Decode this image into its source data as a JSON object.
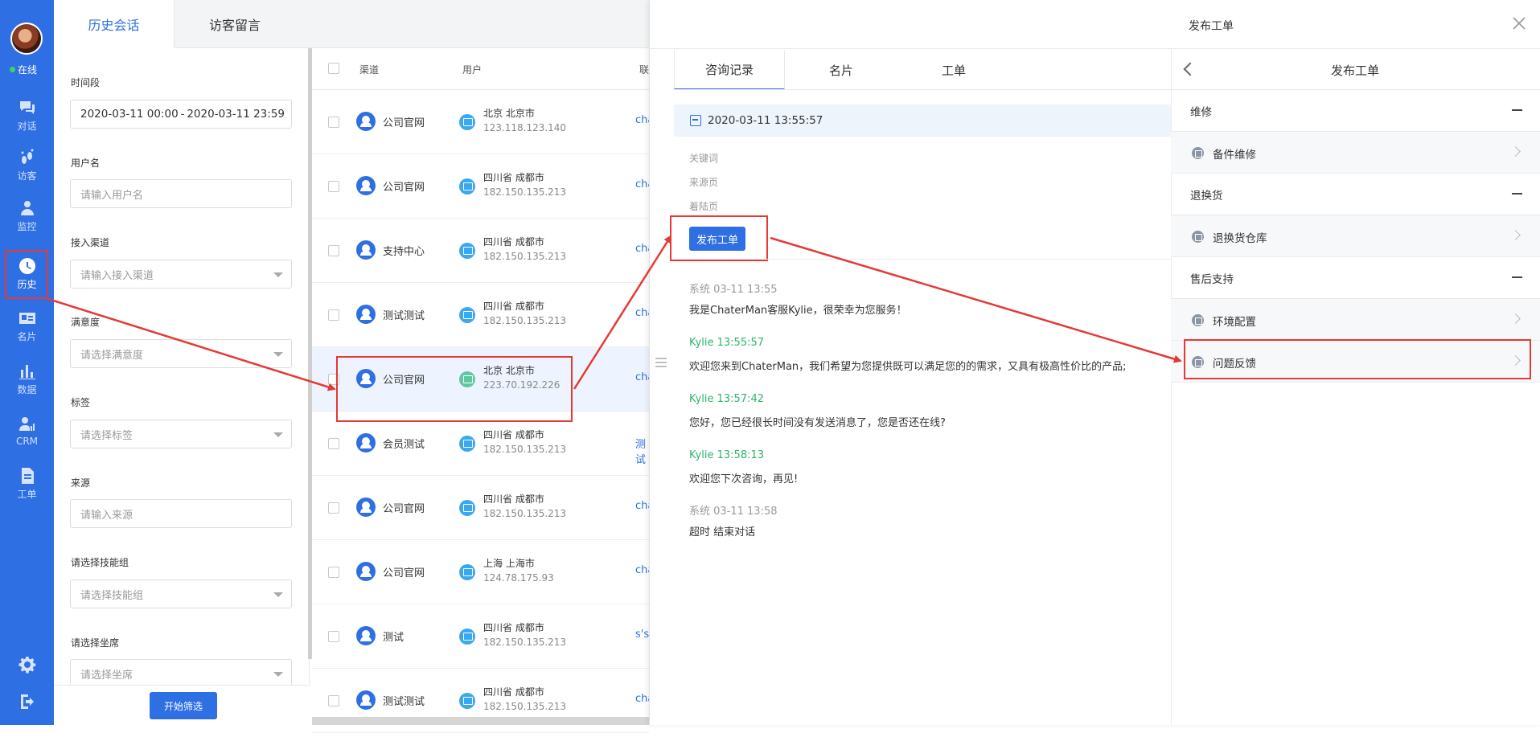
{
  "nav": {
    "status": "在线",
    "items": [
      {
        "label": "对话",
        "icon": "chat-icon"
      },
      {
        "label": "访客",
        "icon": "footprint-icon"
      },
      {
        "label": "监控",
        "icon": "monitor-user-icon"
      },
      {
        "label": "历史",
        "icon": "clock-icon"
      },
      {
        "label": "名片",
        "icon": "card-icon"
      },
      {
        "label": "数据",
        "icon": "bar-chart-icon"
      },
      {
        "label": "CRM",
        "icon": "crm-icon"
      },
      {
        "label": "工单",
        "icon": "ticket-icon"
      }
    ]
  },
  "tabs": {
    "history": "历史会话",
    "messages": "访客留言"
  },
  "filter": {
    "time_label": "时间段",
    "date_start": "2020-03-11 00:00",
    "date_sep": "-",
    "date_end": "2020-03-11 23:59",
    "username_label": "用户名",
    "username_placeholder": "请输入用户名",
    "channel_label": "接入渠道",
    "channel_placeholder": "请输入接入渠道",
    "satisfaction_label": "满意度",
    "satisfaction_placeholder": "请选择满意度",
    "tag_label": "标签",
    "tag_placeholder": "请选择标签",
    "source_label": "来源",
    "source_placeholder": "请输入来源",
    "skill_label": "请选择技能组",
    "skill_placeholder": "请选择技能组",
    "seat_label": "请选择坐席",
    "seat_placeholder": "请选择坐席",
    "submit": "开始筛选"
  },
  "list": {
    "headers": {
      "channel": "渠道",
      "user": "用户",
      "contact": "联"
    },
    "rows": [
      {
        "channel": "公司官网",
        "loc": "北京 北京市",
        "ip": "123.118.123.140",
        "contact": "cha",
        "device": "pc"
      },
      {
        "channel": "公司官网",
        "loc": "四川省 成都市",
        "ip": "182.150.135.213",
        "contact": "cha",
        "device": "pc"
      },
      {
        "channel": "支持中心",
        "loc": "四川省 成都市",
        "ip": "182.150.135.213",
        "contact": "cha",
        "device": "pc"
      },
      {
        "channel": "测试测试",
        "loc": "四川省 成都市",
        "ip": "182.150.135.213",
        "contact": "cha",
        "device": "pc"
      },
      {
        "channel": "公司官网",
        "loc": "北京 北京市",
        "ip": "223.70.192.226",
        "contact": "cha",
        "device": "mobile"
      },
      {
        "channel": "会员测试",
        "loc": "四川省 成都市",
        "ip": "182.150.135.213",
        "contact": "测试",
        "device": "pc"
      },
      {
        "channel": "公司官网",
        "loc": "四川省 成都市",
        "ip": "182.150.135.213",
        "contact": "cha",
        "device": "pc"
      },
      {
        "channel": "公司官网",
        "loc": "上海 上海市",
        "ip": "124.78.175.93",
        "contact": "cha",
        "device": "pc"
      },
      {
        "channel": "测试",
        "loc": "四川省 成都市",
        "ip": "182.150.135.213",
        "contact": "s's",
        "device": "pc"
      },
      {
        "channel": "测试测试",
        "loc": "四川省 成都市",
        "ip": "182.150.135.213",
        "contact": "cha",
        "device": "pc"
      }
    ]
  },
  "detail": {
    "title": "发布工单",
    "tabs": {
      "records": "咨询记录",
      "card": "名片",
      "order": "工单"
    },
    "date": "2020-03-11 13:55:57",
    "meta": {
      "keyword": "关键词",
      "source": "来源页",
      "landing": "着陆页"
    },
    "publish_button": "发布工单",
    "messages": [
      {
        "head": "系统 03-11 13:55",
        "body": "我是ChaterMan客服Kylie，很荣幸为您服务！",
        "agent": false
      },
      {
        "head": "Kylie  13:55:57",
        "body": "欢迎您来到ChaterMan，我们希望为您提供既可以满足您的的需求，又具有极高性价比的产品;",
        "agent": true
      },
      {
        "head": "Kylie  13:57:42",
        "body": "您好，您已经很长时间没有发送消息了，您是否还在线?",
        "agent": true
      },
      {
        "head": "Kylie  13:58:13",
        "body": "欢迎您下次咨询，再见!",
        "agent": true
      },
      {
        "head": "系统 03-11 13:58",
        "body": "超时 结束对话",
        "agent": false
      }
    ]
  },
  "work_order": {
    "title": "发布工单",
    "groups": [
      {
        "name": "维修",
        "items": [
          "备件维修"
        ]
      },
      {
        "name": "退换货",
        "items": [
          "退换货仓库"
        ]
      },
      {
        "name": "售后支持",
        "items": [
          "环境配置",
          "问题反馈"
        ]
      }
    ]
  },
  "colors": {
    "primary": "#2f6fe4",
    "highlight": "#e53935",
    "agent": "#2bb56a"
  }
}
